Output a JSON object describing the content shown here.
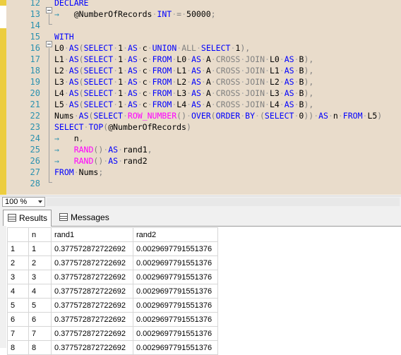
{
  "editor": {
    "lines": [
      {
        "num": "12",
        "tokens": [
          [
            "kw",
            "DECLARE"
          ]
        ]
      },
      {
        "num": "13",
        "tokens": [
          [
            "ar",
            "→   "
          ],
          [
            "vr",
            "@NumberOfRecords"
          ],
          [
            "dt",
            "·"
          ],
          [
            "kw",
            "INT"
          ],
          [
            "dt",
            "·"
          ],
          [
            "gr",
            "="
          ],
          [
            "dt",
            "·"
          ],
          [
            "nm",
            "50000"
          ],
          [
            "gr",
            ";"
          ]
        ]
      },
      {
        "num": "14",
        "tokens": []
      },
      {
        "num": "15",
        "tokens": [
          [
            "kw",
            "WITH"
          ]
        ]
      },
      {
        "num": "16",
        "tokens": [
          [
            "vr",
            "L0"
          ],
          [
            "dt",
            "·"
          ],
          [
            "kw",
            "AS"
          ],
          [
            "gr",
            "("
          ],
          [
            "kw",
            "SELECT"
          ],
          [
            "dt",
            "·"
          ],
          [
            "nm",
            "1"
          ],
          [
            "dt",
            "·"
          ],
          [
            "kw",
            "AS"
          ],
          [
            "dt",
            "·"
          ],
          [
            "vr",
            "c"
          ],
          [
            "dt",
            "·"
          ],
          [
            "kw",
            "UNION"
          ],
          [
            "dt",
            "·"
          ],
          [
            "gr",
            "ALL"
          ],
          [
            "dt",
            "·"
          ],
          [
            "kw",
            "SELECT"
          ],
          [
            "dt",
            "·"
          ],
          [
            "nm",
            "1"
          ],
          [
            "gr",
            "),"
          ]
        ]
      },
      {
        "num": "17",
        "tokens": [
          [
            "vr",
            "L1"
          ],
          [
            "dt",
            "·"
          ],
          [
            "kw",
            "AS"
          ],
          [
            "gr",
            "("
          ],
          [
            "kw",
            "SELECT"
          ],
          [
            "dt",
            "·"
          ],
          [
            "nm",
            "1"
          ],
          [
            "dt",
            "·"
          ],
          [
            "kw",
            "AS"
          ],
          [
            "dt",
            "·"
          ],
          [
            "vr",
            "c"
          ],
          [
            "dt",
            "·"
          ],
          [
            "kw",
            "FROM"
          ],
          [
            "dt",
            "·"
          ],
          [
            "vr",
            "L0"
          ],
          [
            "dt",
            "·"
          ],
          [
            "kw",
            "AS"
          ],
          [
            "dt",
            "·"
          ],
          [
            "vr",
            "A"
          ],
          [
            "dt",
            "·"
          ],
          [
            "gr",
            "CROSS"
          ],
          [
            "dt",
            "·"
          ],
          [
            "gr",
            "JOIN"
          ],
          [
            "dt",
            "·"
          ],
          [
            "vr",
            "L0"
          ],
          [
            "dt",
            "·"
          ],
          [
            "kw",
            "AS"
          ],
          [
            "dt",
            "·"
          ],
          [
            "vr",
            "B"
          ],
          [
            "gr",
            "),"
          ]
        ]
      },
      {
        "num": "18",
        "tokens": [
          [
            "vr",
            "L2"
          ],
          [
            "dt",
            "·"
          ],
          [
            "kw",
            "AS"
          ],
          [
            "gr",
            "("
          ],
          [
            "kw",
            "SELECT"
          ],
          [
            "dt",
            "·"
          ],
          [
            "nm",
            "1"
          ],
          [
            "dt",
            "·"
          ],
          [
            "kw",
            "AS"
          ],
          [
            "dt",
            "·"
          ],
          [
            "vr",
            "c"
          ],
          [
            "dt",
            "·"
          ],
          [
            "kw",
            "FROM"
          ],
          [
            "dt",
            "·"
          ],
          [
            "vr",
            "L1"
          ],
          [
            "dt",
            "·"
          ],
          [
            "kw",
            "AS"
          ],
          [
            "dt",
            "·"
          ],
          [
            "vr",
            "A"
          ],
          [
            "dt",
            "·"
          ],
          [
            "gr",
            "CROSS"
          ],
          [
            "dt",
            "·"
          ],
          [
            "gr",
            "JOIN"
          ],
          [
            "dt",
            "·"
          ],
          [
            "vr",
            "L1"
          ],
          [
            "dt",
            "·"
          ],
          [
            "kw",
            "AS"
          ],
          [
            "dt",
            "·"
          ],
          [
            "vr",
            "B"
          ],
          [
            "gr",
            "),"
          ]
        ]
      },
      {
        "num": "19",
        "tokens": [
          [
            "vr",
            "L3"
          ],
          [
            "dt",
            "·"
          ],
          [
            "kw",
            "AS"
          ],
          [
            "gr",
            "("
          ],
          [
            "kw",
            "SELECT"
          ],
          [
            "dt",
            "·"
          ],
          [
            "nm",
            "1"
          ],
          [
            "dt",
            "·"
          ],
          [
            "kw",
            "AS"
          ],
          [
            "dt",
            "·"
          ],
          [
            "vr",
            "c"
          ],
          [
            "dt",
            "·"
          ],
          [
            "kw",
            "FROM"
          ],
          [
            "dt",
            "·"
          ],
          [
            "vr",
            "L2"
          ],
          [
            "dt",
            "·"
          ],
          [
            "kw",
            "AS"
          ],
          [
            "dt",
            "·"
          ],
          [
            "vr",
            "A"
          ],
          [
            "dt",
            "·"
          ],
          [
            "gr",
            "CROSS"
          ],
          [
            "dt",
            "·"
          ],
          [
            "gr",
            "JOIN"
          ],
          [
            "dt",
            "·"
          ],
          [
            "vr",
            "L2"
          ],
          [
            "dt",
            "·"
          ],
          [
            "kw",
            "AS"
          ],
          [
            "dt",
            "·"
          ],
          [
            "vr",
            "B"
          ],
          [
            "gr",
            "),"
          ]
        ]
      },
      {
        "num": "20",
        "tokens": [
          [
            "vr",
            "L4"
          ],
          [
            "dt",
            "·"
          ],
          [
            "kw",
            "AS"
          ],
          [
            "gr",
            "("
          ],
          [
            "kw",
            "SELECT"
          ],
          [
            "dt",
            "·"
          ],
          [
            "nm",
            "1"
          ],
          [
            "dt",
            "·"
          ],
          [
            "kw",
            "AS"
          ],
          [
            "dt",
            "·"
          ],
          [
            "vr",
            "c"
          ],
          [
            "dt",
            "·"
          ],
          [
            "kw",
            "FROM"
          ],
          [
            "dt",
            "·"
          ],
          [
            "vr",
            "L3"
          ],
          [
            "dt",
            "·"
          ],
          [
            "kw",
            "AS"
          ],
          [
            "dt",
            "·"
          ],
          [
            "vr",
            "A"
          ],
          [
            "dt",
            "·"
          ],
          [
            "gr",
            "CROSS"
          ],
          [
            "dt",
            "·"
          ],
          [
            "gr",
            "JOIN"
          ],
          [
            "dt",
            "·"
          ],
          [
            "vr",
            "L3"
          ],
          [
            "dt",
            "·"
          ],
          [
            "kw",
            "AS"
          ],
          [
            "dt",
            "·"
          ],
          [
            "vr",
            "B"
          ],
          [
            "gr",
            "),"
          ]
        ]
      },
      {
        "num": "21",
        "tokens": [
          [
            "vr",
            "L5"
          ],
          [
            "dt",
            "·"
          ],
          [
            "kw",
            "AS"
          ],
          [
            "gr",
            "("
          ],
          [
            "kw",
            "SELECT"
          ],
          [
            "dt",
            "·"
          ],
          [
            "nm",
            "1"
          ],
          [
            "dt",
            "·"
          ],
          [
            "kw",
            "AS"
          ],
          [
            "dt",
            "·"
          ],
          [
            "vr",
            "c"
          ],
          [
            "dt",
            "·"
          ],
          [
            "kw",
            "FROM"
          ],
          [
            "dt",
            "·"
          ],
          [
            "vr",
            "L4"
          ],
          [
            "dt",
            "·"
          ],
          [
            "kw",
            "AS"
          ],
          [
            "dt",
            "·"
          ],
          [
            "vr",
            "A"
          ],
          [
            "dt",
            "·"
          ],
          [
            "gr",
            "CROSS"
          ],
          [
            "dt",
            "·"
          ],
          [
            "gr",
            "JOIN"
          ],
          [
            "dt",
            "·"
          ],
          [
            "vr",
            "L4"
          ],
          [
            "dt",
            "·"
          ],
          [
            "kw",
            "AS"
          ],
          [
            "dt",
            "·"
          ],
          [
            "vr",
            "B"
          ],
          [
            "gr",
            "),"
          ]
        ]
      },
      {
        "num": "22",
        "tokens": [
          [
            "vr",
            "Nums"
          ],
          [
            "dt",
            "·"
          ],
          [
            "kw",
            "AS"
          ],
          [
            "gr",
            "("
          ],
          [
            "kw",
            "SELECT"
          ],
          [
            "dt",
            "·"
          ],
          [
            "fn",
            "ROW_NUMBER"
          ],
          [
            "gr",
            "()"
          ],
          [
            "dt",
            "·"
          ],
          [
            "kw",
            "OVER"
          ],
          [
            "gr",
            "("
          ],
          [
            "kw",
            "ORDER"
          ],
          [
            "dt",
            "·"
          ],
          [
            "kw",
            "BY"
          ],
          [
            "dt",
            "·"
          ],
          [
            "gr",
            "("
          ],
          [
            "kw",
            "SELECT"
          ],
          [
            "dt",
            "·"
          ],
          [
            "nm",
            "0"
          ],
          [
            "gr",
            "))"
          ],
          [
            "dt",
            "·"
          ],
          [
            "kw",
            "AS"
          ],
          [
            "dt",
            "·"
          ],
          [
            "vr",
            "n"
          ],
          [
            "dt",
            "·"
          ],
          [
            "kw",
            "FROM"
          ],
          [
            "dt",
            "·"
          ],
          [
            "vr",
            "L5"
          ],
          [
            "gr",
            ")"
          ]
        ]
      },
      {
        "num": "23",
        "tokens": [
          [
            "kw",
            "SELECT"
          ],
          [
            "dt",
            "·"
          ],
          [
            "kw",
            "TOP"
          ],
          [
            "gr",
            "("
          ],
          [
            "vr",
            "@NumberOfRecords"
          ],
          [
            "gr",
            ")"
          ]
        ]
      },
      {
        "num": "24",
        "tokens": [
          [
            "ar",
            "→   "
          ],
          [
            "vr",
            "n"
          ],
          [
            "gr",
            ","
          ]
        ]
      },
      {
        "num": "25",
        "tokens": [
          [
            "ar",
            "→   "
          ],
          [
            "fn",
            "RAND"
          ],
          [
            "gr",
            "()"
          ],
          [
            "dt",
            "·"
          ],
          [
            "kw",
            "AS"
          ],
          [
            "dt",
            "·"
          ],
          [
            "vr",
            "rand1"
          ],
          [
            "gr",
            ","
          ]
        ]
      },
      {
        "num": "26",
        "tokens": [
          [
            "ar",
            "→   "
          ],
          [
            "fn",
            "RAND"
          ],
          [
            "gr",
            "()"
          ],
          [
            "dt",
            "·"
          ],
          [
            "kw",
            "AS"
          ],
          [
            "dt",
            "·"
          ],
          [
            "vr",
            "rand2"
          ]
        ]
      },
      {
        "num": "27",
        "tokens": [
          [
            "kw",
            "FROM"
          ],
          [
            "dt",
            "·"
          ],
          [
            "vr",
            "Nums"
          ],
          [
            "gr",
            ";"
          ]
        ]
      },
      {
        "num": "28",
        "tokens": []
      }
    ]
  },
  "zoom": {
    "value": "100 %"
  },
  "tabs": {
    "results": "Results",
    "messages": "Messages"
  },
  "grid": {
    "columns": [
      "n",
      "rand1",
      "rand2"
    ],
    "rows": [
      [
        "1",
        "1",
        "0.377572872722692",
        "0.0029697791551376"
      ],
      [
        "2",
        "2",
        "0.377572872722692",
        "0.0029697791551376"
      ],
      [
        "3",
        "3",
        "0.377572872722692",
        "0.0029697791551376"
      ],
      [
        "4",
        "4",
        "0.377572872722692",
        "0.0029697791551376"
      ],
      [
        "5",
        "5",
        "0.377572872722692",
        "0.0029697791551376"
      ],
      [
        "6",
        "6",
        "0.377572872722692",
        "0.0029697791551376"
      ],
      [
        "7",
        "7",
        "0.377572872722692",
        "0.0029697791551376"
      ],
      [
        "8",
        "8",
        "0.377572872722692",
        "0.0029697791551376"
      ]
    ]
  },
  "colors": {
    "editor_bg": "#e9dccb",
    "keyword": "#0000ff",
    "function": "#ff00ff",
    "operator": "#808080",
    "line_number": "#2b91af"
  }
}
